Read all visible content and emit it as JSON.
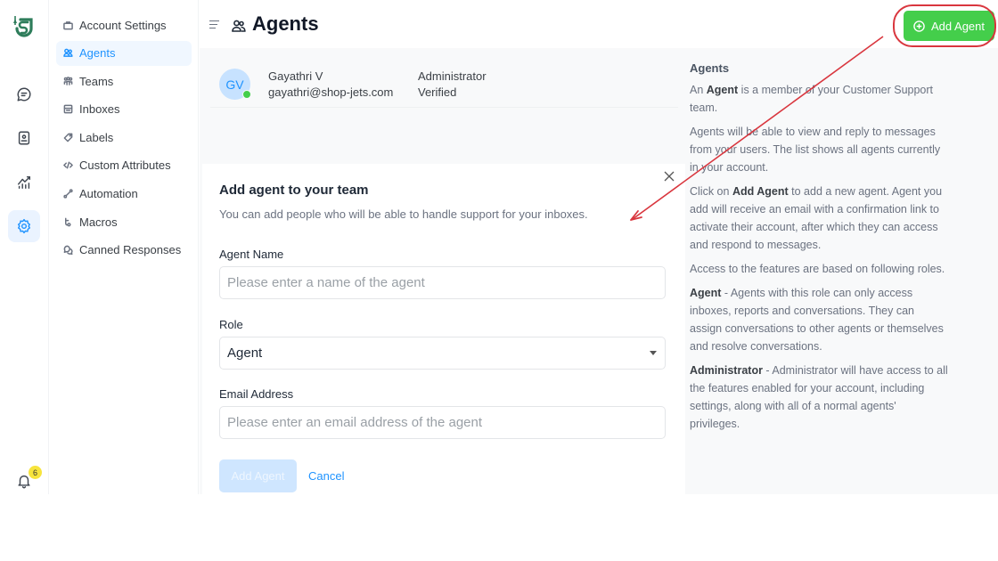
{
  "rail": {
    "logo_icon": "shop-jets-logo",
    "items": [
      {
        "icon": "chat-bubble-icon",
        "label": "Conversations"
      },
      {
        "icon": "contact-book-icon",
        "label": "Contacts"
      },
      {
        "icon": "reports-chart-icon",
        "label": "Reports"
      },
      {
        "icon": "settings-gear-icon",
        "label": "Settings",
        "active": true
      }
    ],
    "notifications": {
      "icon": "bell-icon",
      "count": "6"
    }
  },
  "sidebar": {
    "items": [
      {
        "label": "Account Settings",
        "icon": "briefcase-icon"
      },
      {
        "label": "Agents",
        "icon": "people-icon",
        "active": true
      },
      {
        "label": "Teams",
        "icon": "team-icon"
      },
      {
        "label": "Inboxes",
        "icon": "inbox-icon"
      },
      {
        "label": "Labels",
        "icon": "tag-icon"
      },
      {
        "label": "Custom Attributes",
        "icon": "code-icon"
      },
      {
        "label": "Automation",
        "icon": "automation-icon"
      },
      {
        "label": "Macros",
        "icon": "macros-icon"
      },
      {
        "label": "Canned Responses",
        "icon": "chat-multiple-icon"
      }
    ]
  },
  "header": {
    "title": "Agents",
    "add_button_label": "Add Agent"
  },
  "agents": [
    {
      "initials": "GV",
      "name": "Gayathri V",
      "email": "gayathri@shop-jets.com",
      "role": "Administrator",
      "status": "Verified",
      "online": true
    }
  ],
  "modal": {
    "title": "Add agent to your team",
    "subtitle": "You can add people who will be able to handle support for your inboxes.",
    "name_label": "Agent Name",
    "name_value": "",
    "name_placeholder": "Please enter a name of the agent",
    "role_label": "Role",
    "role_value": "Agent",
    "email_label": "Email Address",
    "email_value": "",
    "email_placeholder": "Please enter an email address of the agent",
    "submit_label": "Add Agent",
    "cancel_label": "Cancel"
  },
  "help": {
    "title": "Agents",
    "p1_pre": "An ",
    "p1_bold": "Agent",
    "p1_post": " is a member of your Customer Support team.",
    "p2": "Agents will be able to view and reply to messages from your users. The list shows all agents currently in your account.",
    "p3_pre": "Click on ",
    "p3_bold": "Add Agent",
    "p3_post": " to add a new agent. Agent you add will receive an email with a confirmation link to activate their account, after which they can access and respond to messages.",
    "p4": "Access to the features are based on following roles.",
    "p5_bold": "Agent",
    "p5_post": " - Agents with this role can only access inboxes, reports and conversations. They can assign conversations to other agents or themselves and resolve conversations.",
    "p6_bold": "Administrator",
    "p6_post": " - Administrator will have access to all the features enabled for your account, including settings, along with all of a normal agents' privileges."
  },
  "colors": {
    "brand_green": "#2e7d5b",
    "accent_blue": "#1f93ff",
    "add_button_green": "#44ce4b",
    "annotation_red": "#d9363e",
    "badge_yellow": "#f7e43c"
  }
}
